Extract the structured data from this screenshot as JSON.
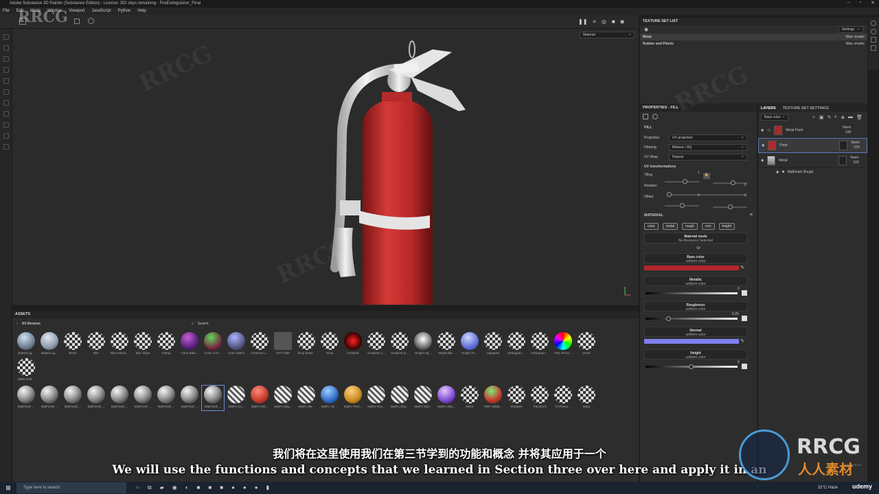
{
  "window": {
    "title": "Adobe Substance 3D Painter (Substance Edition) - License: 352 days remaining - FireExtinguisher_Final"
  },
  "watermark": "RRCG",
  "menu": [
    "File",
    "Edit",
    "Mode",
    "Window",
    "Viewport",
    "JavaScript",
    "Python",
    "Help"
  ],
  "viewport": {
    "mode_select": "Material"
  },
  "assets": {
    "title": "ASSETS",
    "library": "All libraries",
    "search_placeholder": "Search",
    "row1": [
      "Baked Lig...",
      "Baked Lig...",
      "Bevel",
      "Blur",
      "Blur Directi...",
      "Blur Slope",
      "Clamp",
      "Color Bala...",
      "Color Corr...",
      "Color Match",
      "Contrast L...",
      "CRT Filter",
      "Drop Shad...",
      "Glow",
      "Gradient",
      "Gradient C...",
      "Gradient D...",
      "Height Adj...",
      "Height Ble...",
      "Height To ...",
      "Highpass",
      "Histogram ...",
      "Histogram ...",
      "HSL Perce...",
      "Invert",
      "Mask Outl..."
    ],
    "row2": [
      "MatFinish ...",
      "MatFinish ...",
      "MatFinish ...",
      "MatFinish ...",
      "MatFinish ...",
      "MatFinish ...",
      "MatFinish ...",
      "MatFinish ...",
      "MatFinish ...",
      "MatFx Co...",
      "MatFx Det...",
      "MatFx Edg...",
      "MatFx HB...",
      "MatFx Oil ...",
      "MatFx Peel...",
      "MatFx Rus...",
      "MatFx Shu...",
      "MatFx Wat...",
      "MatFx Wat...",
      "Mirror",
      "PBR Valida...",
      "Sharpen",
      "Transform",
      "Tri-Planar ...",
      "Warp"
    ]
  },
  "texture_set_list": {
    "title": "TEXTURE SET LIST",
    "settings_label": "Settings",
    "items": [
      {
        "name": "Metal",
        "shader": "Main shader"
      },
      {
        "name": "Rubber and Plastic",
        "shader": "Main shader"
      }
    ]
  },
  "properties": {
    "title": "PROPERTIES - FILL",
    "fill_label": "FILL",
    "projection_label": "Projection",
    "projection_value": "UV projection",
    "filtering_label": "Filtering",
    "filtering_value": "Bilinear | HQ",
    "uvwrap_label": "UV Wrap",
    "uvwrap_value": "Repeat",
    "uvtrans_label": "UV transformations",
    "tiling_label": "Tiling",
    "tiling_value": "1",
    "rotation_label": "Rotation",
    "rotation_value": "0",
    "offset_label": "Offset",
    "offset_x": "0",
    "offset_y": "0",
    "material_label": "MATERIAL",
    "channels": [
      "color",
      "metal",
      "rough",
      "nrm",
      "height"
    ],
    "material_mode_label": "Material mode",
    "material_mode_value": "No Resource Selected",
    "or_label": "Or",
    "uniform": "uniform color",
    "base_color_label": "Base color",
    "metallic_label": "Metallic",
    "metallic_value": "0",
    "roughness_label": "Roughness",
    "roughness_value": "0.25",
    "normal_label": "Normal",
    "height_label": "Height",
    "height_value": "0",
    "colors": {
      "base": "#b3282c",
      "normal": "#8080f0"
    }
  },
  "layers": {
    "tab_layers": "LAYERS",
    "tab_tss": "TEXTURE SET SETTINGS",
    "channel_select": "Base color",
    "items": [
      {
        "name": "Metal Paint",
        "blend": "Norm",
        "opacity": "100"
      },
      {
        "name": "Paint",
        "blend": "Norm",
        "opacity": "100"
      },
      {
        "name": "Metal",
        "blend": "Norm",
        "opacity": "100"
      }
    ],
    "effect": "MatFinish Rough"
  },
  "subtitles": {
    "cn": "我们将在这里使用我们在第三节学到的功能和概念 并将其应用于一个",
    "en": "We will use the functions and concepts that we learned in Section three over here and apply it in an"
  },
  "taskbar": {
    "search_placeholder": "Type here to search",
    "weather": "32°C  Haze",
    "brand_cn": "人人素材",
    "brand": "udemy"
  },
  "status": {
    "version": "Version: 8.1.1"
  }
}
